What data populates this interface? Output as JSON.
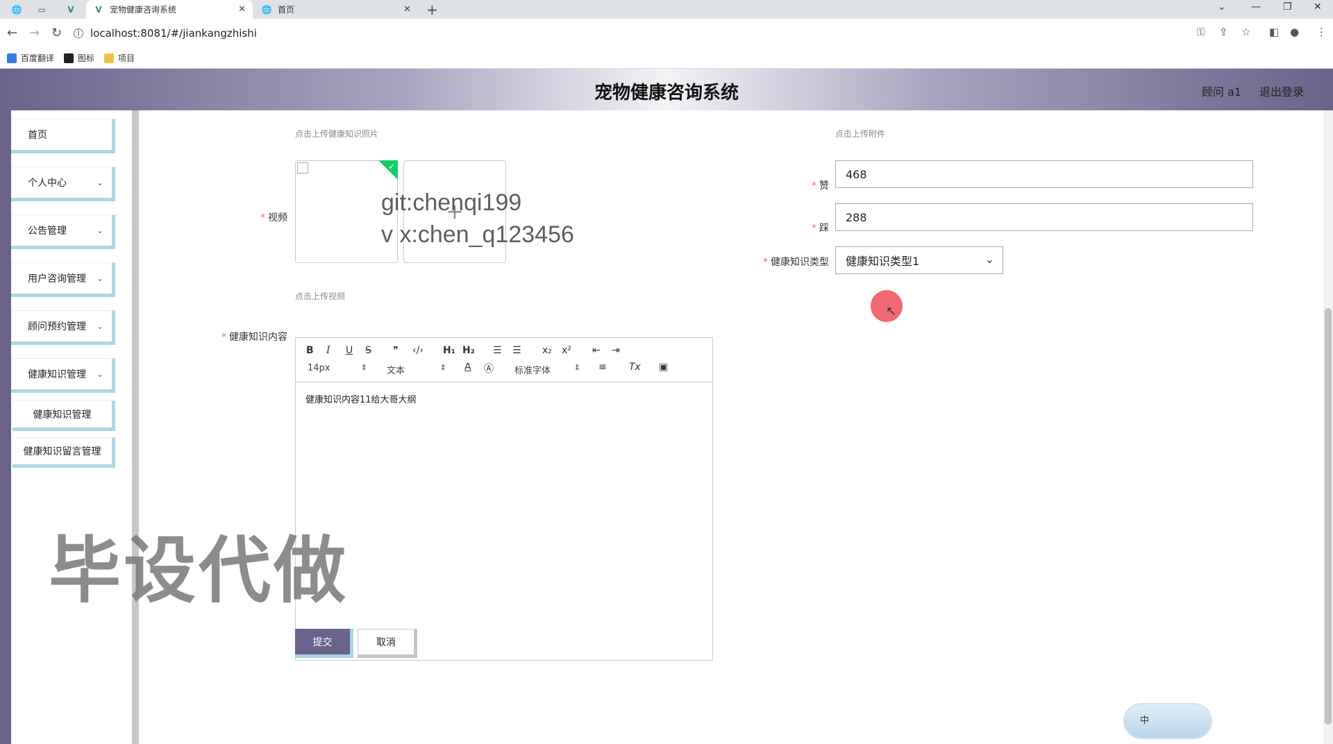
{
  "browser": {
    "tabs": [
      {
        "title": "宠物健康咨询系统",
        "active": true
      },
      {
        "title": "首页",
        "active": false
      }
    ],
    "url": "localhost:8081/#/jiankangzhishi",
    "bookmarks": [
      "百度翻译",
      "图标",
      "项目"
    ]
  },
  "header": {
    "title": "宠物健康咨询系统",
    "user": "顾问 a1",
    "logout": "退出登录"
  },
  "sidebar": {
    "items": [
      {
        "label": "首页"
      },
      {
        "label": "个人中心"
      },
      {
        "label": "公告管理"
      },
      {
        "label": "用户咨询管理"
      },
      {
        "label": "顾问预约管理"
      },
      {
        "label": "健康知识管理"
      }
    ],
    "subitems": [
      {
        "label": "健康知识管理"
      },
      {
        "label": "健康知识留言管理"
      }
    ]
  },
  "form": {
    "photo_hint": "点击上传健康知识照片",
    "attachment_hint": "点击上传附件",
    "video_label": "视频",
    "video_hint": "点击上传视频",
    "upload_plus": "+",
    "content_label": "健康知识内容",
    "like_label": "赞",
    "like_value": "468",
    "dislike_label": "踩",
    "dislike_value": "288",
    "type_label": "健康知识类型",
    "type_value": "健康知识类型1"
  },
  "watermark": {
    "line1": "git:chenqi199",
    "line2": "v x:chen_q123456",
    "big": "毕设代做"
  },
  "editor": {
    "font_size": "14px",
    "heading": "文本",
    "font_family": "标准字体",
    "content": "健康知识内容11给大哥大纲"
  },
  "buttons": {
    "submit": "提交",
    "cancel": "取消"
  },
  "ime": {
    "label": "中"
  }
}
